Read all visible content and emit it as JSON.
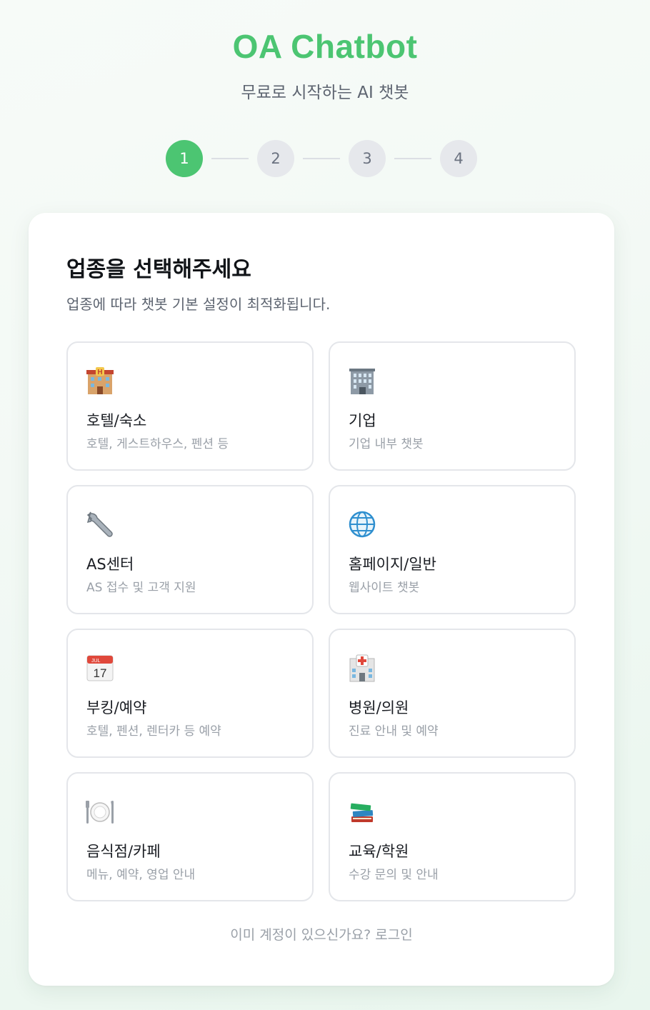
{
  "header": {
    "title": "OA Chatbot",
    "subtitle": "무료로 시작하는 AI 챗봇"
  },
  "stepper": {
    "steps": [
      "1",
      "2",
      "3",
      "4"
    ],
    "current": 1
  },
  "card": {
    "title": "업종을 선택해주세요",
    "description": "업종에 따라 챗봇 기본 설정이 최적화됩니다.",
    "options": [
      {
        "icon": "hotel-icon",
        "label": "호텔/숙소",
        "desc": "호텔, 게스트하우스, 펜션 등"
      },
      {
        "icon": "office-building-icon",
        "label": "기업",
        "desc": "기업 내부 챗봇"
      },
      {
        "icon": "wrench-icon",
        "label": "AS센터",
        "desc": "AS 접수 및 고객 지원"
      },
      {
        "icon": "globe-icon",
        "label": "홈페이지/일반",
        "desc": "웹사이트 챗봇"
      },
      {
        "icon": "calendar-icon",
        "label": "부킹/예약",
        "desc": "호텔, 펜션, 렌터카 등 예약"
      },
      {
        "icon": "hospital-icon",
        "label": "병원/의원",
        "desc": "진료 안내 및 예약"
      },
      {
        "icon": "plate-cutlery-icon",
        "label": "음식점/카페",
        "desc": "메뉴, 예약, 영업 안내"
      },
      {
        "icon": "books-icon",
        "label": "교육/학원",
        "desc": "수강 문의 및 안내"
      }
    ],
    "calendar_month": "JUL",
    "calendar_day": "17",
    "login_prompt": "이미 계정이 있으신가요?",
    "login_link": "로그인"
  },
  "colors": {
    "accent": "#4cc572",
    "step_inactive": "#e6e8ec",
    "text_muted": "#9aa0a8"
  }
}
